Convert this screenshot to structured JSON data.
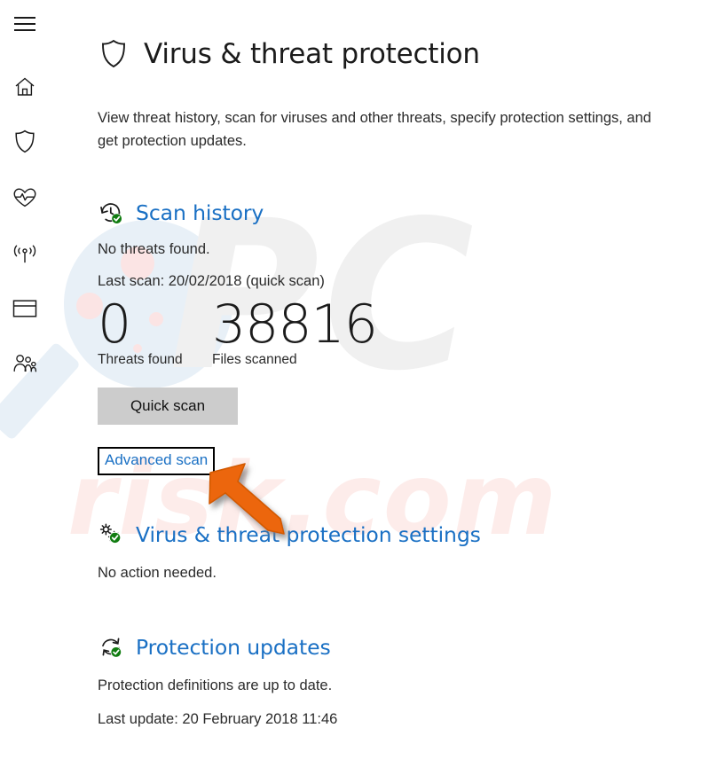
{
  "app": {
    "accent_blue": "#1a70c4",
    "green_check": "#107c10",
    "button_gray": "#cccccc",
    "annotation_orange": "#ec6608",
    "text_dark": "#1b1b1b"
  },
  "sidebar": {
    "items": [
      {
        "name": "hamburger-menu",
        "icon": "hamburger-icon",
        "label": "Menu"
      },
      {
        "name": "home",
        "icon": "home-icon",
        "label": "Home"
      },
      {
        "name": "virus-threat-protection",
        "icon": "shield-icon",
        "label": "Virus & threat protection"
      },
      {
        "name": "device-performance-health",
        "icon": "heart-pulse-icon",
        "label": "Device performance & health"
      },
      {
        "name": "firewall-network-protection",
        "icon": "wifi-broadcast-icon",
        "label": "Firewall & network protection"
      },
      {
        "name": "app-browser-control",
        "icon": "browser-window-icon",
        "label": "App & browser control"
      },
      {
        "name": "family-options",
        "icon": "family-people-icon",
        "label": "Family options"
      }
    ]
  },
  "header": {
    "icon": "shield-icon",
    "title": "Virus & threat protection",
    "description": "View threat history, scan for viruses and other threats, specify protection settings, and get protection updates."
  },
  "scan_history": {
    "icon": "history-clock-check-icon",
    "title": "Scan history",
    "status": "No threats found.",
    "last_scan": "Last scan: 20/02/2018 (quick scan)",
    "stats": [
      {
        "value": "0",
        "label": "Threats found"
      },
      {
        "value": "38816",
        "label": "Files scanned"
      }
    ],
    "quick_scan_button": "Quick scan",
    "advanced_scan_link": "Advanced scan"
  },
  "settings": {
    "icon": "gears-check-icon",
    "title": "Virus & threat protection settings",
    "status": "No action needed."
  },
  "updates": {
    "icon": "refresh-check-icon",
    "title": "Protection updates",
    "status": "Protection definitions are up to date.",
    "last_update": "Last update: 20 February 2018 11:46"
  },
  "watermark": {
    "text_primary": "PC",
    "text_secondary": "risk.com"
  }
}
